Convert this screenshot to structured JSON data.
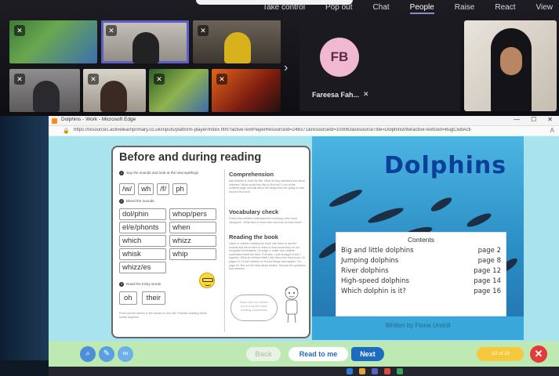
{
  "meeting": {
    "toolbar": [
      {
        "label": "Take control",
        "active": false
      },
      {
        "label": "Pop out",
        "active": false
      },
      {
        "label": "Chat",
        "active": false
      },
      {
        "label": "People",
        "active": true
      },
      {
        "label": "Raise",
        "active": false
      },
      {
        "label": "React",
        "active": false
      },
      {
        "label": "View",
        "active": false
      }
    ],
    "featured": {
      "initials": "FB",
      "name": "Fareesa Fah...",
      "avatar_color": "#f0b8d1"
    }
  },
  "browser": {
    "window_title": "Dolphins - Work - Microsoft Edge",
    "url": "https://resources.activelearnprimary.co.uk/inputs/platform-player/index.htm?activeTextPlayerResourceId=248371&resourceId=109063&resourceTitle=DolphinsInteractiveTextGen=BugClubActi"
  },
  "worksheet": {
    "title": "Before and during reading",
    "step1": "Say the sounds and look at the new spellings",
    "sounds": [
      "/w/",
      "wh",
      "/f/",
      "ph"
    ],
    "step2": "Blend the sounds",
    "words": [
      [
        "dol/phin",
        "whop/pers"
      ],
      [
        "el/e/phonts",
        "when"
      ],
      [
        "which",
        "whizz"
      ],
      [
        "whisk",
        "whip"
      ],
      [
        "whizz/es",
        ""
      ]
    ],
    "step3": "Read the tricky words",
    "tricky": [
      "oh",
      "their"
    ],
    "fineprint": "Point out the letters in the words on the left. Practise reading these words together.",
    "comprehension_heading": "Comprehension",
    "comprehension_text": "Ask children to read the title. What do they already know about dolphins? What would they like to find out? Look at the contents page and talk about the things they are going to read about in the book.",
    "vocab_heading": "Vocabulary check",
    "vocab_text": "Check that children understand the meaning of the word 'whoppers'. What does it mean here and how do they know?",
    "reading_heading": "Reading the book",
    "reading_text": "Listen to children reading the book. Ask them to use the sounds and blend them in order to read words they do not recognise immediately. On page 4, make sure children understand what the word 'it' means. Look at pages 6 and 7 together. What do children think? Ask them how they know. On pages 12-13 ask children to find the things that happen. On page 16, find out the facts about whales. Discuss the questions and answers.",
    "bubble": "Make this non-fiction book a whole class reading experience"
  },
  "book": {
    "title": "Dolphins",
    "contents_heading": "Contents",
    "contents": [
      {
        "item": "Big and little dolphins",
        "page": "page 2"
      },
      {
        "item": "Jumping dolphins",
        "page": "page 8"
      },
      {
        "item": "River dolphins",
        "page": "page 12"
      },
      {
        "item": "High-speed dolphins",
        "page": "page 14"
      },
      {
        "item": "Which dolphin is it?",
        "page": "page 16"
      }
    ],
    "author": "Written by Fiona Undrill"
  },
  "controls": {
    "back": "Back",
    "read": "Read to me",
    "next": "Next",
    "page": "1/2 of 18"
  },
  "colors": {
    "accent": "#5b5fc7",
    "next_blue": "#1d6cc4",
    "close_red": "#e23b3b",
    "bottom_green": "#bfe9b2"
  }
}
